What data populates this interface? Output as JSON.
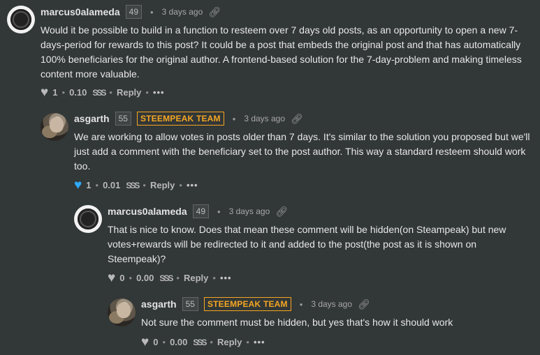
{
  "comments": [
    {
      "author": "marcus0alameda",
      "reputation": "49",
      "badge": "",
      "time": "3 days ago",
      "text": "Would it be possible to build in a function to resteem over 7 days old posts, as an opportunity to open a new 7-days-period for rewards to this post? It could be a post that embeds the original post and that has automatically 100% beneficiaries for the original author. A frontend-based solution for the 7-day-problem and making timeless content more valuable.",
      "votes": "1",
      "payout": "0.10",
      "reply_label": "Reply",
      "voted": false
    },
    {
      "author": "asgarth",
      "reputation": "55",
      "badge": "STEEMPEAK TEAM",
      "time": "3 days ago",
      "text": "We are working to allow votes in posts older than 7 days. It's similar to the solution you proposed but we'll just add a comment with the beneficiary set to the post author. This way a standard resteem should work too.",
      "votes": "1",
      "payout": "0.01",
      "reply_label": "Reply",
      "voted": true
    },
    {
      "author": "marcus0alameda",
      "reputation": "49",
      "badge": "",
      "time": "3 days ago",
      "text": "That is nice to know. Does that mean these comment will be hidden(on Steampeak) but new votes+rewards will be redirected to it and added to the post(the post as it is shown on Steempeak)?",
      "votes": "0",
      "payout": "0.00",
      "reply_label": "Reply",
      "voted": false
    },
    {
      "author": "asgarth",
      "reputation": "55",
      "badge": "STEEMPEAK TEAM",
      "time": "3 days ago",
      "text": "Not sure the comment must be hidden, but yes that's how it should work",
      "votes": "0",
      "payout": "0.00",
      "reply_label": "Reply",
      "voted": false
    }
  ],
  "symbols": {
    "dot": "•",
    "more": "•••",
    "steem": "SSS"
  },
  "colors": {
    "background": "#323737",
    "badge": "#f5a623",
    "voted_heart": "#2ea9ff"
  },
  "icons": {
    "avatar_marcus": "ring-avatar",
    "avatar_asgarth": "photo-avatar",
    "vote": "heart-icon",
    "link": "link-icon",
    "currency": "steem-icon",
    "more": "more-icon"
  }
}
